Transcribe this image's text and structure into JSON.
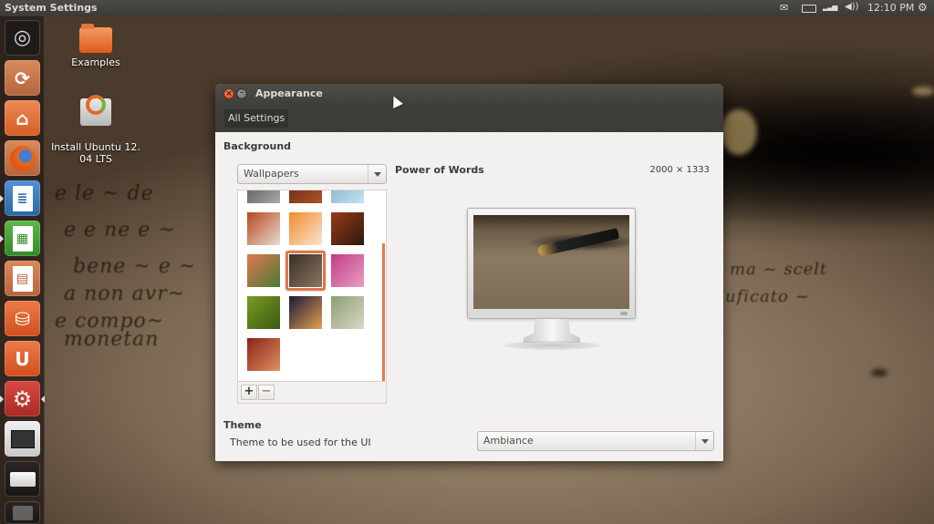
{
  "top_panel": {
    "title": "System Settings",
    "indicators": [
      {
        "name": "mail-icon",
        "glyph": "✉"
      },
      {
        "name": "battery-icon",
        "glyph": "▭"
      },
      {
        "name": "network-icon",
        "glyph": "▂▃▅"
      },
      {
        "name": "volume-icon",
        "glyph": "🔊"
      }
    ],
    "clock": "12:10 PM",
    "session_icon": "⏻"
  },
  "launcher": {
    "items": [
      {
        "name": "dash-home",
        "glyph": "◉",
        "color": "#2b2623"
      },
      {
        "name": "install-ubuntu",
        "glyph": "⟳",
        "color": "#c9754a"
      },
      {
        "name": "home-folder",
        "glyph": "⌂",
        "color": "#e26a2c"
      },
      {
        "name": "firefox",
        "glyph": "●",
        "color": "#d8622a"
      },
      {
        "name": "libreoffice-writer",
        "glyph": "≣",
        "color": "#3a7dc2"
      },
      {
        "name": "libreoffice-calc",
        "glyph": "▦",
        "color": "#48a03a"
      },
      {
        "name": "libreoffice-impress",
        "glyph": "▤",
        "color": "#c9754a"
      },
      {
        "name": "ubuntu-software-center",
        "glyph": "⛁",
        "color": "#e0582a"
      },
      {
        "name": "ubuntu-one",
        "glyph": "U",
        "color": "#e0582a"
      },
      {
        "name": "system-settings",
        "glyph": "⚙",
        "color": "#c23a34"
      },
      {
        "name": "workspace-switcher",
        "glyph": "▦",
        "color": "#d8d8d8"
      },
      {
        "name": "removable-drive",
        "glyph": "▭",
        "color": "#3a3430"
      },
      {
        "name": "trash",
        "glyph": "▯",
        "color": "#3a3430"
      }
    ]
  },
  "desktop_icons": [
    {
      "label": "Examples"
    },
    {
      "label": "Install Ubuntu 12.\n04 LTS"
    }
  ],
  "window": {
    "title": "Appearance",
    "all_settings_label": "All Settings",
    "background_section": "Background",
    "wallpaper_source": "Wallpapers",
    "selected_wallpaper_name": "Power of Words",
    "selected_wallpaper_size": "2000 × 1333",
    "wallpaper_thumbnails": [
      {
        "name": "partial-1",
        "colors": [
          "#4c4c4c",
          "#a9a9a9"
        ]
      },
      {
        "name": "partial-2",
        "colors": [
          "#5a2a10",
          "#b0502a"
        ]
      },
      {
        "name": "partial-3",
        "colors": [
          "#7aaac8",
          "#c6e2ee"
        ]
      },
      {
        "name": "autumn-trees",
        "colors": [
          "#b8471c",
          "#e6ddd3"
        ]
      },
      {
        "name": "orange-leaves",
        "colors": [
          "#f38a2c",
          "#f8e7cf"
        ]
      },
      {
        "name": "sunset-valley",
        "colors": [
          "#9a3a17",
          "#2a1a10"
        ]
      },
      {
        "name": "poppies",
        "colors": [
          "#e17850",
          "#4a7a34"
        ]
      },
      {
        "name": "power-of-words",
        "colors": [
          "#3a2e22",
          "#8a7660"
        ],
        "selected": true
      },
      {
        "name": "magenta-flower",
        "colors": [
          "#c23a8a",
          "#e8a0c0"
        ]
      },
      {
        "name": "green-plant",
        "colors": [
          "#7a9a24",
          "#3a5a14"
        ]
      },
      {
        "name": "night-horse",
        "colors": [
          "#1a1838",
          "#e4a050"
        ]
      },
      {
        "name": "grass",
        "colors": [
          "#8aa070",
          "#d8d8c8"
        ]
      },
      {
        "name": "red-blur",
        "colors": [
          "#8a2418",
          "#e09060"
        ]
      }
    ],
    "add_button": "+",
    "remove_button": "−",
    "theme_section": "Theme",
    "theme_description": "Theme to be used for the UI",
    "theme_value": "Ambiance"
  },
  "colors": {
    "accent": "#e2764a",
    "titlebar": "#3c3b37",
    "content_bg": "#f2f1f0"
  }
}
